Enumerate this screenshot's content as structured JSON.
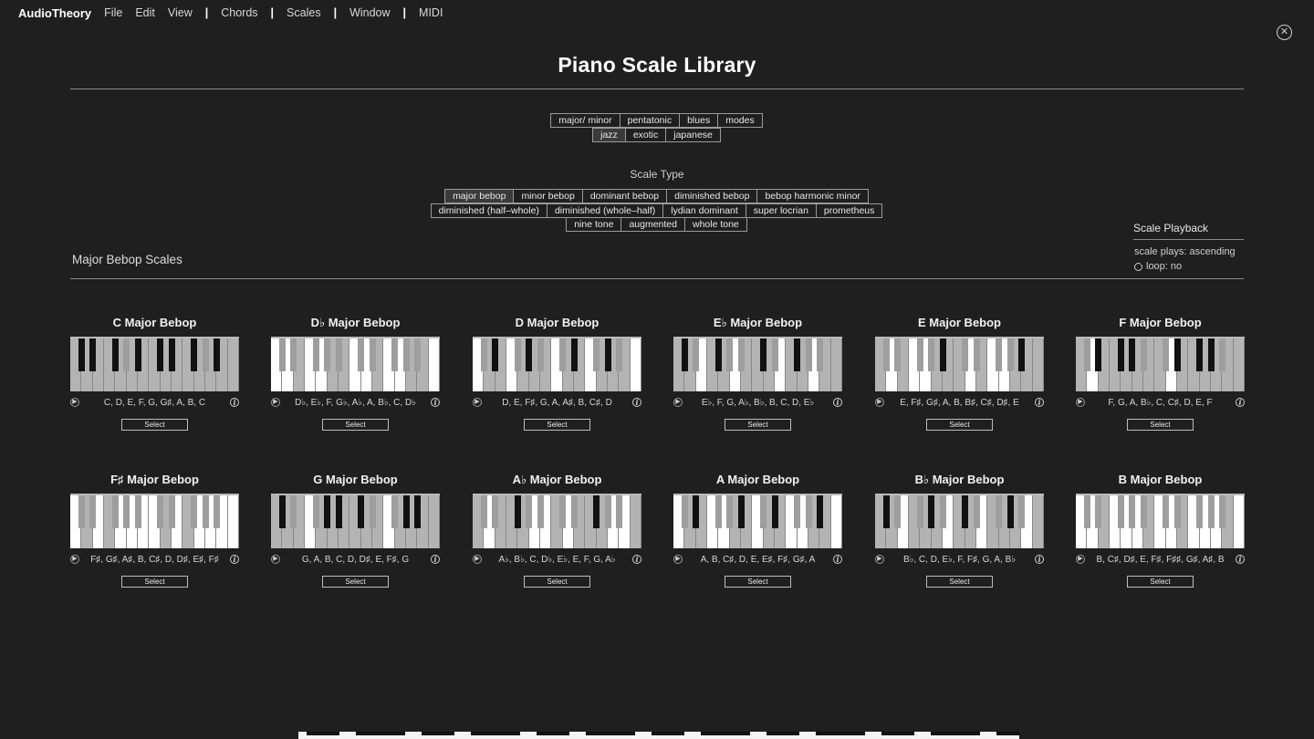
{
  "menu": {
    "brand": "AudioTheory",
    "items": [
      "File",
      "Edit",
      "View",
      "|",
      "Chords",
      "|",
      "Scales",
      "|",
      "Window",
      "|",
      "MIDI"
    ]
  },
  "page_title": "Piano Scale Library",
  "categories": {
    "row1": [
      "major/ minor",
      "pentatonic",
      "blues",
      "modes"
    ],
    "row2": [
      "jazz",
      "exotic",
      "japanese"
    ],
    "active": "jazz"
  },
  "scale_type": {
    "label": "Scale Type",
    "row1": [
      "major bebop",
      "minor bebop",
      "dominant bebop",
      "diminished bebop",
      "bebop harmonic minor"
    ],
    "row2": [
      "diminished (half–whole)",
      "diminished (whole–half)",
      "lydian dominant",
      "super locrian",
      "prometheus"
    ],
    "row3": [
      "nine tone",
      "augmented",
      "whole tone"
    ],
    "active": "major bebop"
  },
  "playback": {
    "header": "Scale Playback",
    "direction": "scale plays: ascending",
    "loop": "loop: no"
  },
  "section_title": "Major Bebop Scales",
  "select_label": "Select",
  "cards": [
    {
      "title": "C Major Bebop",
      "notes": "C, D, E, F, G, G♯, A, B, C",
      "hl": [
        0,
        1,
        2,
        3,
        4,
        5,
        6,
        0
      ],
      "bhl": [
        3
      ]
    },
    {
      "title": "D♭ Major Bebop",
      "notes": "D♭, E♭, F, G♭, A♭, A, B♭, C, D♭",
      "hl": [
        2,
        5,
        6
      ],
      "bhl": [
        0,
        1,
        2,
        3,
        4
      ]
    },
    {
      "title": "D Major Bebop",
      "notes": "D, E, F♯, G, A, A♯, B, C♯, D",
      "hl": [
        1,
        2,
        4,
        5,
        6
      ],
      "bhl": [
        2,
        4,
        0
      ]
    },
    {
      "title": "E♭ Major Bebop",
      "notes": "E♭, F, G, A♭, B♭, B, C, D, E♭",
      "hl": [
        0,
        1,
        3,
        4,
        6
      ],
      "bhl": [
        1,
        3,
        4
      ]
    },
    {
      "title": "E Major Bebop",
      "notes": "E, F♯, G♯, A, B, B♯, C♯, D♯, E",
      "hl": [
        2,
        5,
        6,
        0
      ],
      "bhl": [
        0,
        1,
        2,
        3
      ]
    },
    {
      "title": "F Major Bebop",
      "notes": "F, G, A, B♭, C, C♯, D, E, F",
      "hl": [
        0,
        2,
        3,
        4,
        5,
        6
      ],
      "bhl": [
        4,
        0
      ]
    },
    {
      "title": "F♯ Major Bebop",
      "notes": "F♯, G♯, A♯, B, C♯, D, D♯, E♯, F♯",
      "hl": [
        3,
        1
      ],
      "bhl": [
        0,
        1,
        2,
        3,
        4
      ]
    },
    {
      "title": "G Major Bebop",
      "notes": "G, A, B, C, D, D♯, E, F♯, G",
      "hl": [
        0,
        1,
        2,
        4,
        5,
        6
      ],
      "bhl": [
        1,
        2
      ]
    },
    {
      "title": "A♭ Major Bebop",
      "notes": "A♭, B♭, C, D♭, E♭, E, F, G, A♭",
      "hl": [
        0,
        2,
        3,
        4
      ],
      "bhl": [
        0,
        1,
        3,
        4
      ]
    },
    {
      "title": "A Major Bebop",
      "notes": "A, B, C♯, D, E, E♯, F♯, G♯, A",
      "hl": [
        1,
        2,
        5,
        6
      ],
      "bhl": [
        0,
        2,
        3
      ]
    },
    {
      "title": "B♭ Major Bebop",
      "notes": "B♭, C, D, E♭, F, F♯, G, A, B♭",
      "hl": [
        0,
        1,
        3,
        4,
        5
      ],
      "bhl": [
        1,
        2,
        4
      ]
    },
    {
      "title": "B Major Bebop",
      "notes": "B, C♯, D♯, E, F♯, F♯♯, G♯, A♯, B",
      "hl": [
        2,
        6
      ],
      "bhl": [
        0,
        1,
        2,
        3,
        4
      ]
    }
  ],
  "icons": {
    "play": "play-icon",
    "info": "info-icon",
    "close": "close-icon",
    "loop": "loop-icon"
  }
}
